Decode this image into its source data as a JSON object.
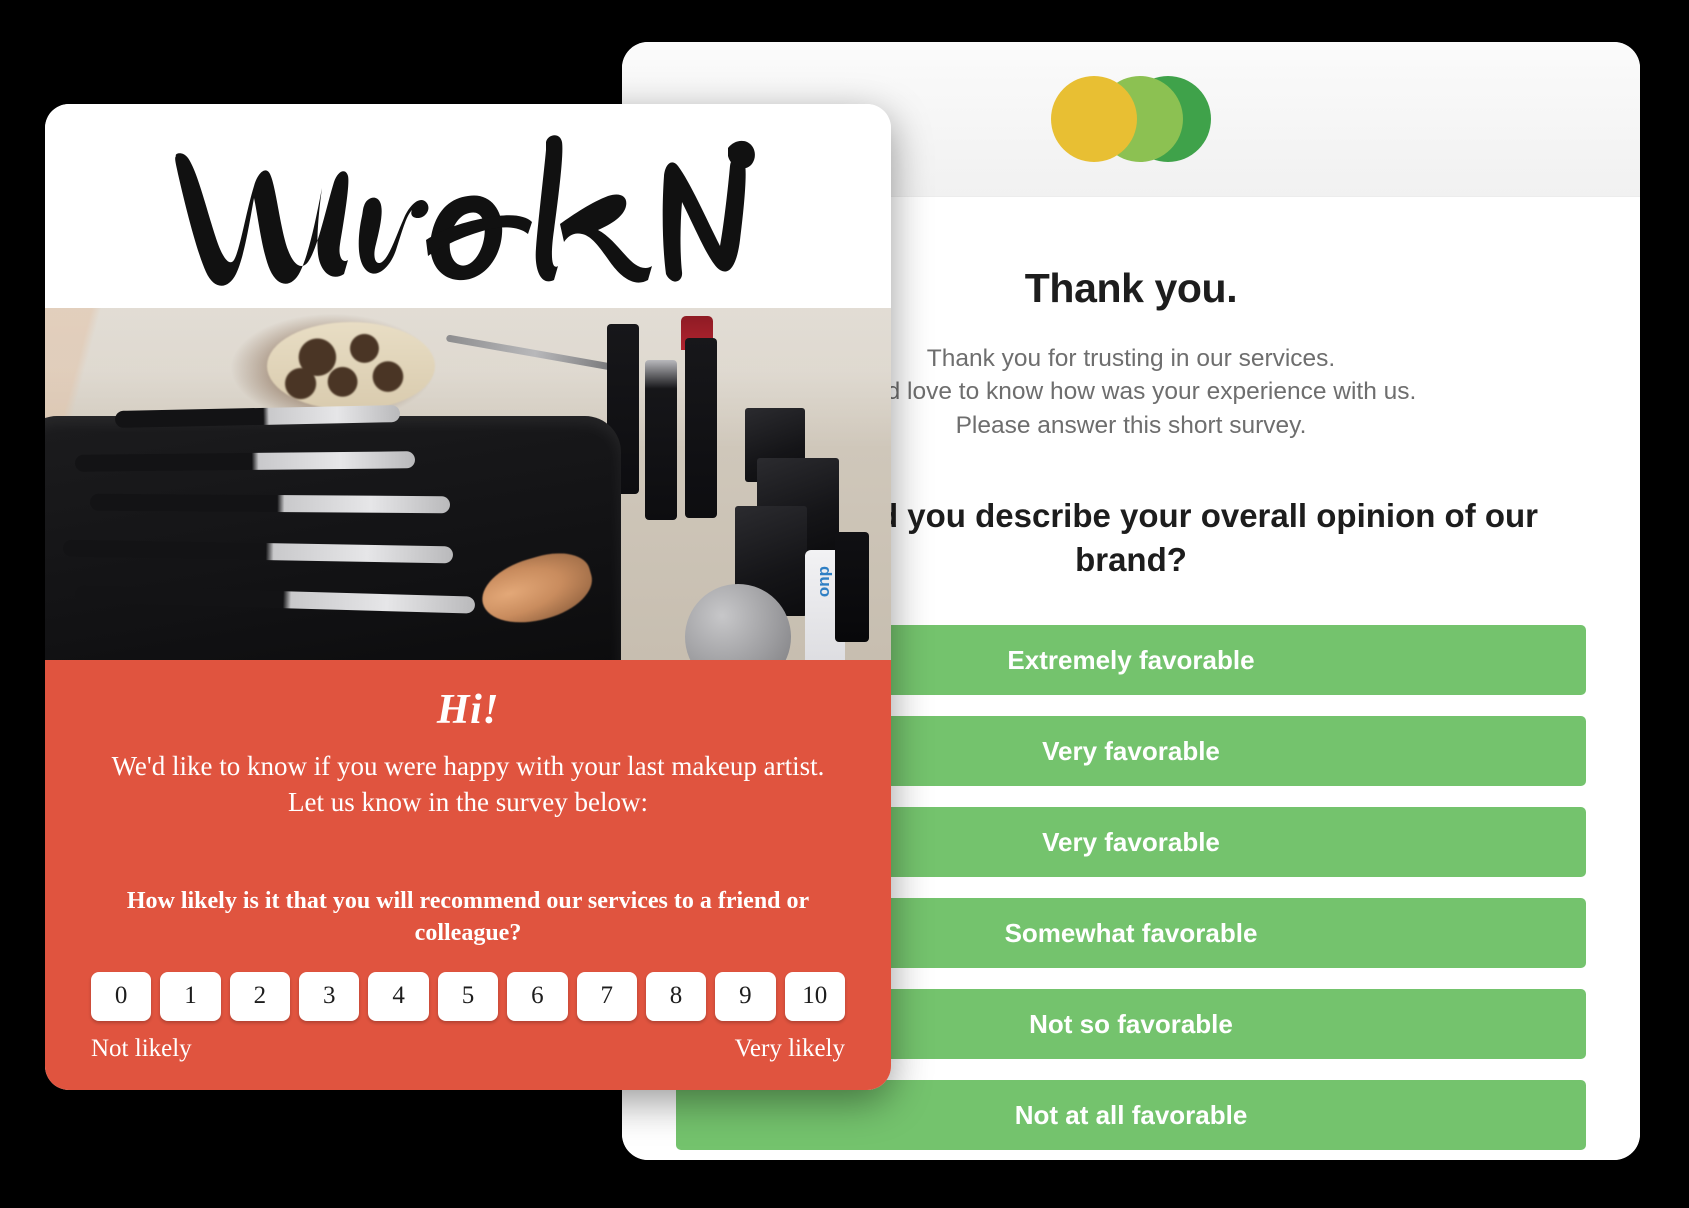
{
  "survey_card": {
    "logo": {
      "name": "brand-logo-three-circles",
      "colors": {
        "yellow": "#e8bf33",
        "light_green": "#8cc152",
        "dark_green": "#3fa24a"
      }
    },
    "title": "Thank you.",
    "intro_lines": [
      "Thank you for trusting in our services.",
      "We'd love to know how was your experience with us.",
      "Please answer this short survey."
    ],
    "question": "How would you describe your overall opinion of our brand?",
    "answer_color": "#74c36d",
    "answers": [
      "Extremely favorable",
      "Very favorable",
      "Very favorable",
      "Somewhat favorable",
      "Not so favorable",
      "Not at all favorable"
    ]
  },
  "email_card": {
    "brand_wordmark": "WORN",
    "hero_image_alt": "makeup-brushes-and-cosmetics-on-table",
    "panel_color": "#e0543f",
    "greeting": "Hi!",
    "intro_lines": [
      "We'd like to know if you were happy with your last makeup artist.",
      "Let us know in the survey below:"
    ],
    "nps_question": "How likely is it that you will recommend our services to a friend or colleague?",
    "nps_values": [
      "0",
      "1",
      "2",
      "3",
      "4",
      "5",
      "6",
      "7",
      "8",
      "9",
      "10"
    ],
    "nps_low_label": "Not likely",
    "nps_high_label": "Very likely"
  }
}
